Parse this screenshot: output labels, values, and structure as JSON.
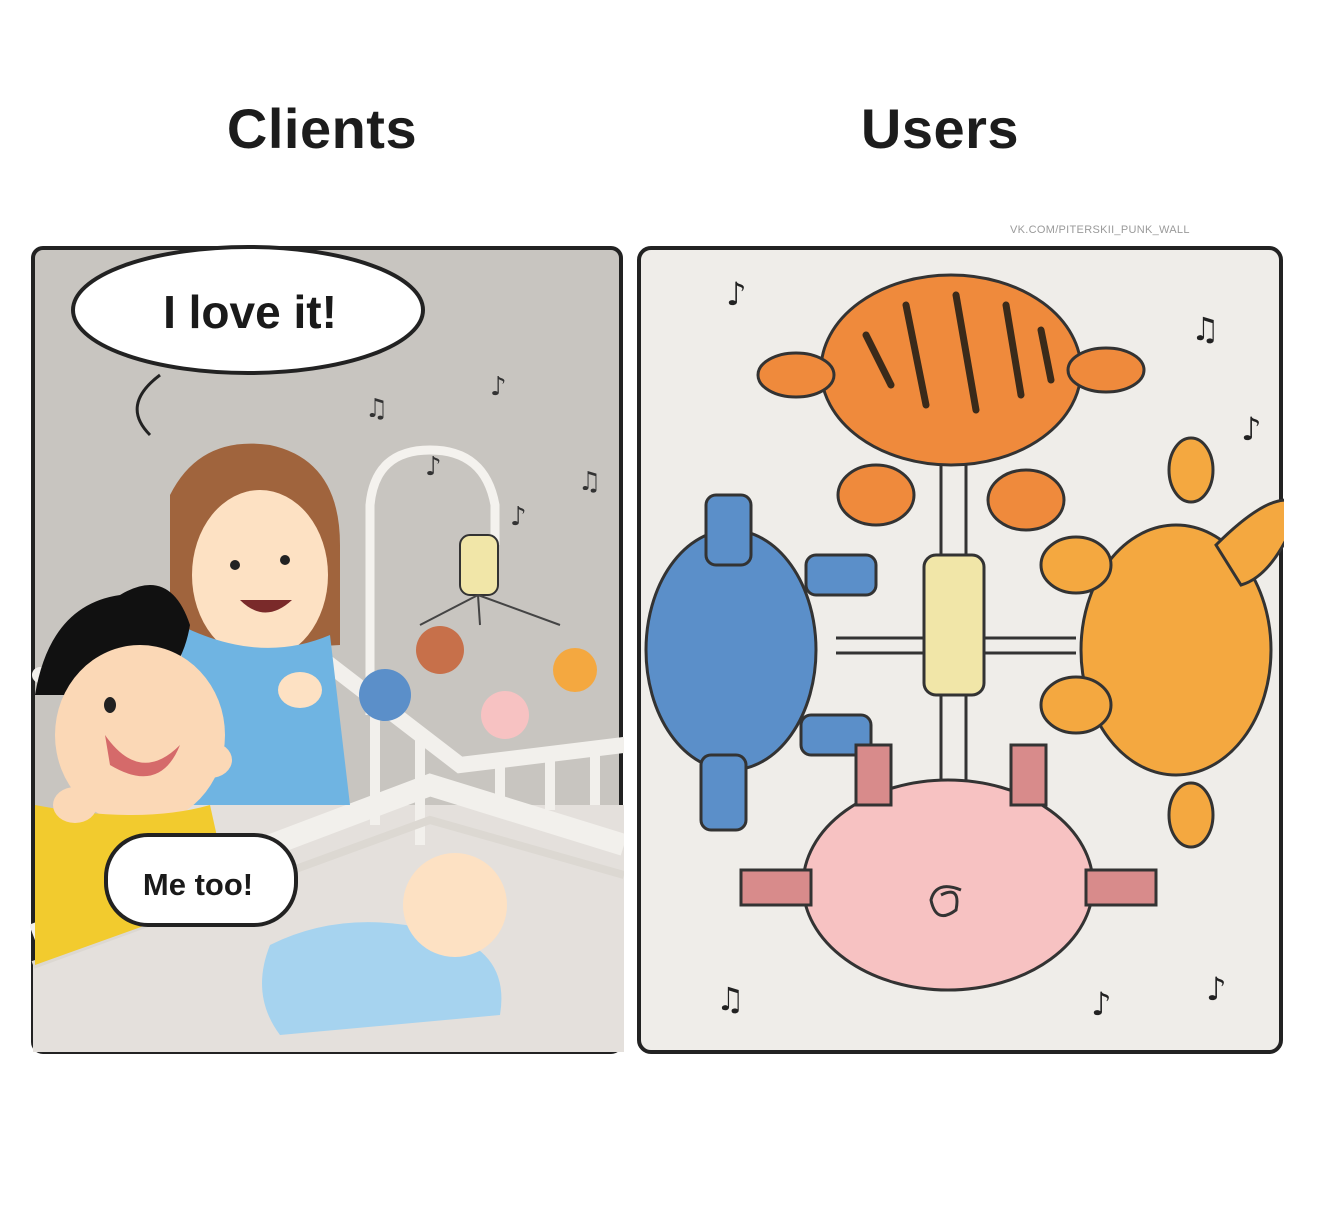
{
  "panels": {
    "left": {
      "heading": "Clients",
      "speech_main": "I love it!",
      "speech_reply": "Me too!"
    },
    "right": {
      "heading": "Users",
      "watermark": "VK.COM/PITERSKII_PUNK_WALL"
    }
  },
  "colors": {
    "panel_bg_left": "#c8c5c0",
    "panel_bg_right": "#efede9",
    "tiger": "#ef8a3c",
    "elephant": "#5b8fc9",
    "fox": "#f4a840",
    "pig": "#f7c2c2",
    "baby_suit": "#a6d3ef",
    "mom_shirt": "#6fb4e2",
    "dad_shirt": "#f2cb2e"
  },
  "icons": [
    "music-note-icon",
    "speech-bubble-icon"
  ]
}
